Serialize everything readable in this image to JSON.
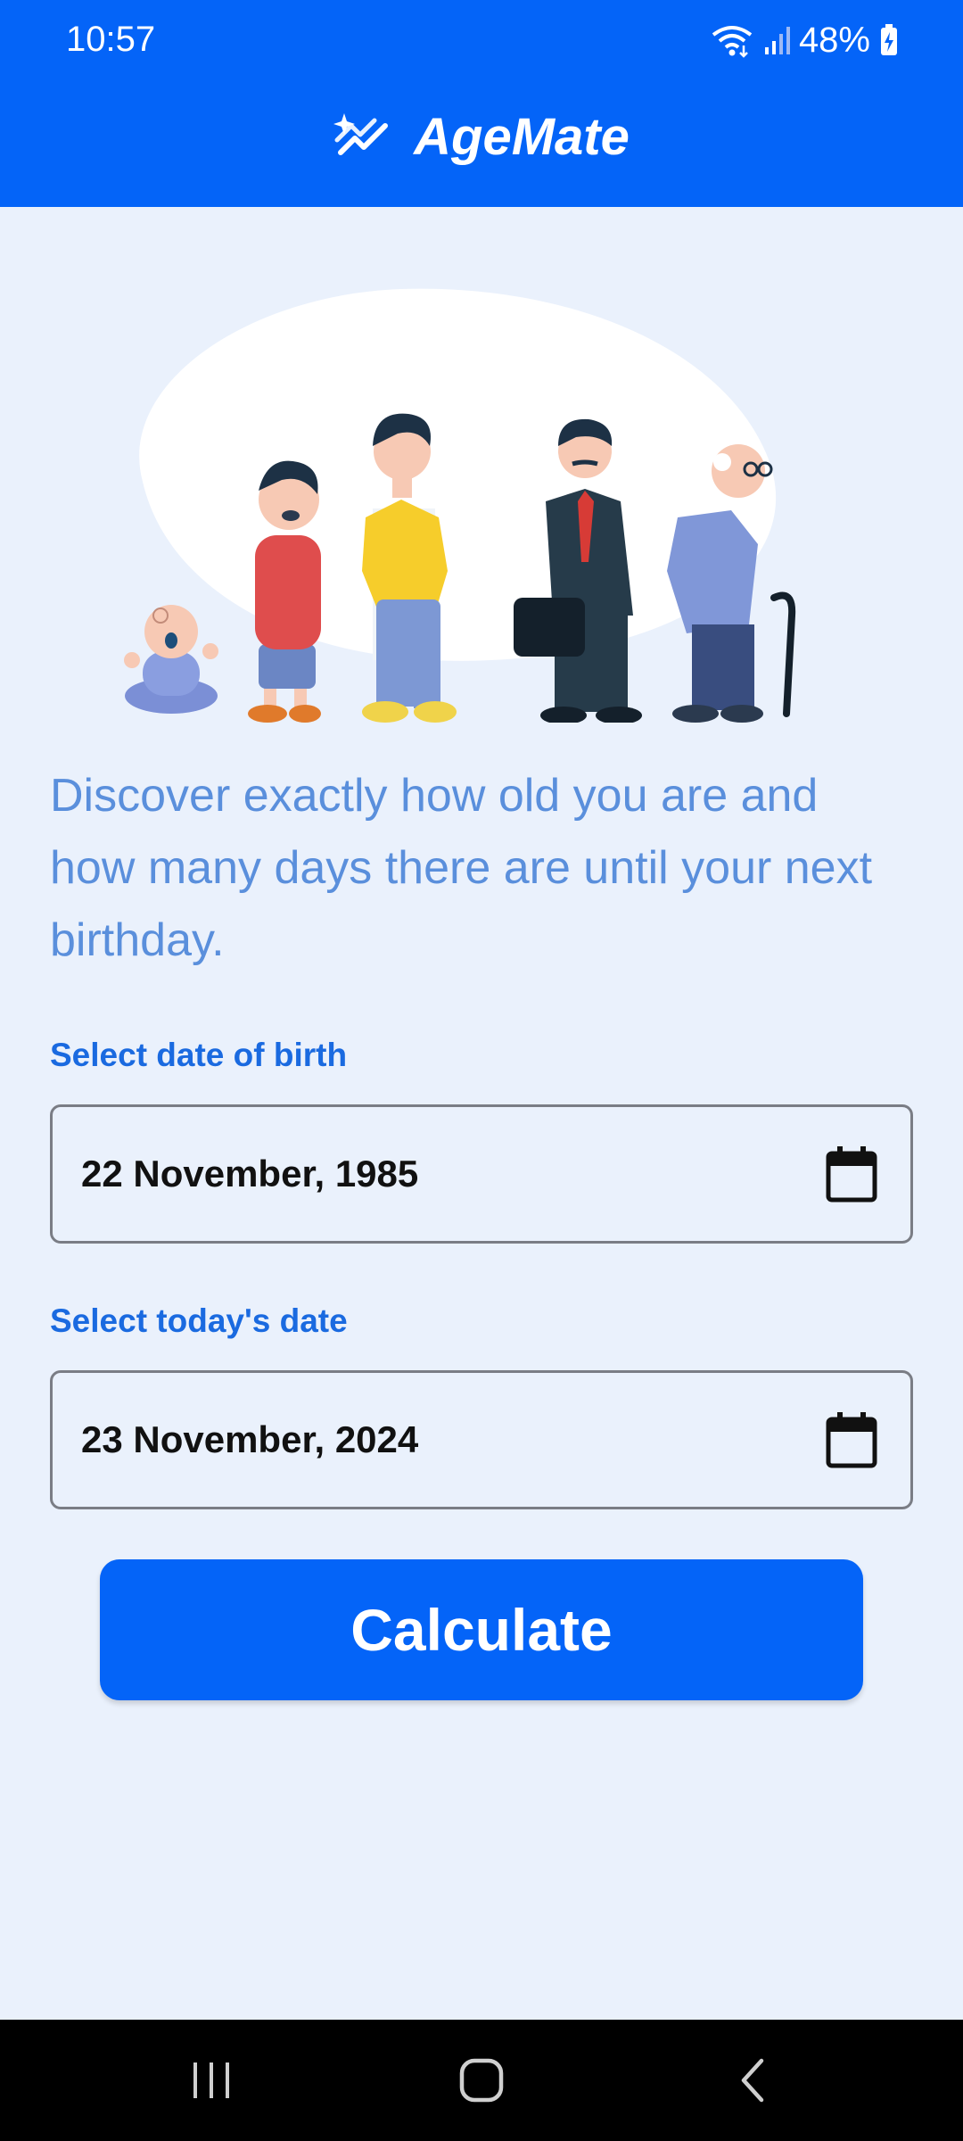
{
  "status_bar": {
    "time": "10:57",
    "battery": "48%"
  },
  "app": {
    "title": "AgeMate",
    "icon": "sparkle-chart-icon",
    "accent_color": "#0464f8"
  },
  "intro_text": "Discover exactly how old you are and how many days there are until your next birthday.",
  "birth_date": {
    "label": "Select date of birth",
    "value": "22 November, 1985"
  },
  "today_date": {
    "label": "Select today's date",
    "value": "23 November, 2024"
  },
  "calculate_button": {
    "label": "Calculate"
  },
  "nav": {
    "recents_icon": "recents-icon",
    "home_icon": "home-icon",
    "back_icon": "back-icon"
  }
}
